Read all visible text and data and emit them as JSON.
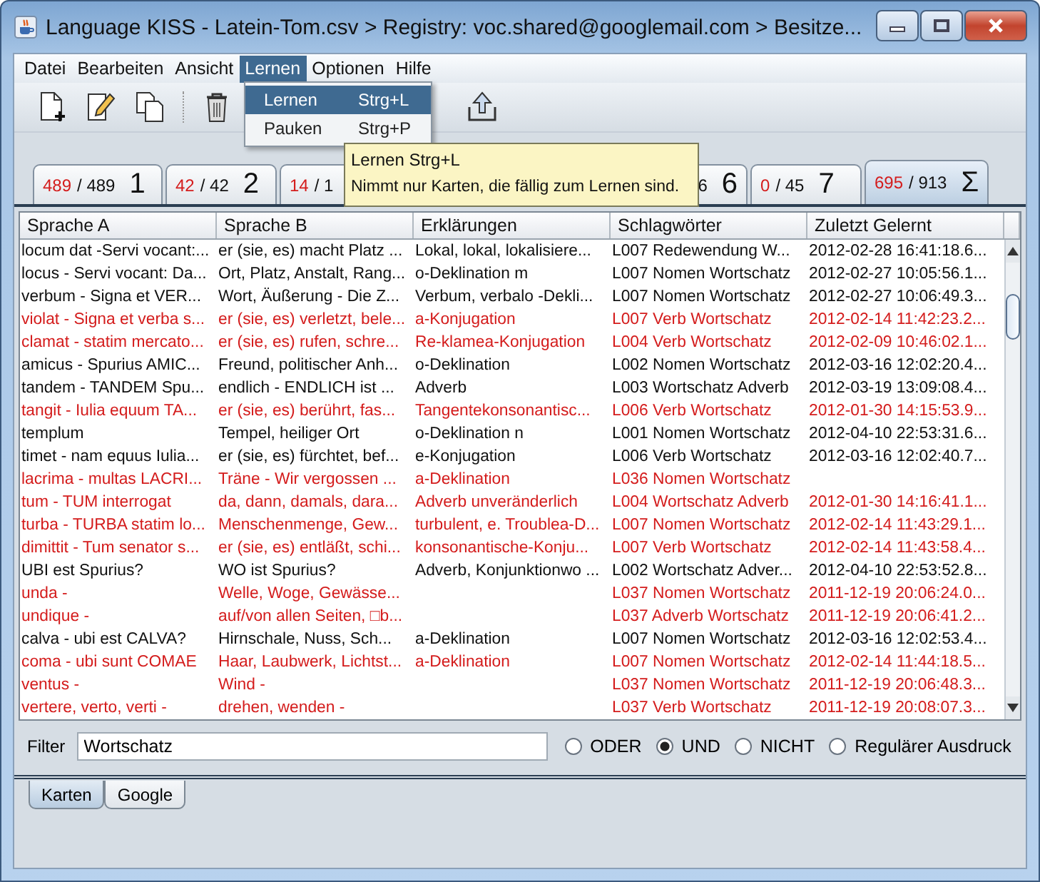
{
  "window": {
    "title": "Language KISS - Latein-Tom.csv > Registry: voc.shared@googlemail.com > Besitze..."
  },
  "menu": [
    {
      "label": "Datei",
      "selected": false
    },
    {
      "label": "Bearbeiten",
      "selected": false
    },
    {
      "label": "Ansicht",
      "selected": false
    },
    {
      "label": "Lernen",
      "selected": true
    },
    {
      "label": "Optionen",
      "selected": false
    },
    {
      "label": "Hilfe",
      "selected": false
    }
  ],
  "dropdown": [
    {
      "label": "Lernen",
      "shortcut": "Strg+L",
      "selected": true
    },
    {
      "label": "Pauken",
      "shortcut": "Strg+P",
      "selected": false
    }
  ],
  "toolbar": [
    {
      "kind": "new"
    },
    {
      "kind": "edit"
    },
    {
      "kind": "copy"
    },
    {
      "kind": "separator"
    },
    {
      "kind": "delete"
    },
    {
      "kind": "upload"
    }
  ],
  "tooltip": {
    "title": "Lernen Strg+L",
    "text": "Nimmt nur Karten, die fällig zum Lernen sind."
  },
  "deck_tabs": [
    {
      "due": "489",
      "rest": "/ 489",
      "number": "1",
      "selected": false
    },
    {
      "due": "42",
      "rest": "/ 42",
      "number": "2",
      "selected": false
    },
    {
      "due": "14",
      "rest": "/ 1",
      "selected": false,
      "kind": "covered"
    },
    {
      "rest": "6",
      "number": "6",
      "selected": false,
      "kind": "covered-right"
    },
    {
      "due": "0",
      "rest": "/ 45",
      "number": "7",
      "selected": false
    },
    {
      "due": "695",
      "rest": "/ 913",
      "number": "Σ",
      "selected": true
    }
  ],
  "table": {
    "columns": [
      "Sprache A",
      "Sprache B",
      "Erklärungen",
      "Schlagwörter",
      "Zuletzt Gelernt"
    ],
    "rows": [
      {
        "due": false,
        "cells": [
          "locum dat -Servi vocant:...",
          "er (sie, es) macht Platz ...",
          "Lokal, lokal, lokalisiere...",
          "L007 Redewendung W...",
          "2012-02-28 16:41:18.6..."
        ]
      },
      {
        "due": false,
        "cells": [
          "locus - Servi vocant: Da...",
          "Ort, Platz, Anstalt, Rang...",
          "o-Deklination m",
          "L007 Nomen Wortschatz",
          "2012-02-27 10:05:56.1..."
        ]
      },
      {
        "due": false,
        "cells": [
          "verbum - Signa et VER...",
          "Wort, Äußerung - Die Z...",
          "Verbum, verbalo -Dekli...",
          "L007 Nomen Wortschatz",
          "2012-02-27 10:06:49.3..."
        ]
      },
      {
        "due": true,
        "cells": [
          "violat - Signa et verba s...",
          "er (sie, es) verletzt, bele...",
          "a-Konjugation",
          "L007 Verb Wortschatz",
          "2012-02-14 11:42:23.2..."
        ]
      },
      {
        "due": true,
        "cells": [
          "clamat - statim mercato...",
          "er (sie, es) rufen, schre...",
          "Re-klamea-Konjugation",
          "L004 Verb Wortschatz",
          "2012-02-09 10:46:02.1..."
        ]
      },
      {
        "due": false,
        "cells": [
          "amicus - Spurius AMIC...",
          "Freund, politischer Anh...",
          "o-Deklination",
          "L002 Nomen Wortschatz",
          "2012-03-16 12:02:20.4..."
        ]
      },
      {
        "due": false,
        "cells": [
          "tandem - TANDEM Spu...",
          "endlich - ENDLICH ist ...",
          "Adverb",
          "L003 Wortschatz Adverb",
          "2012-03-19 13:09:08.4..."
        ]
      },
      {
        "due": true,
        "cells": [
          "tangit - Iulia equum TA...",
          "er (sie, es) berührt, fas...",
          "Tangentekonsonantisc...",
          "L006 Verb Wortschatz",
          "2012-01-30 14:15:53.9..."
        ]
      },
      {
        "due": false,
        "cells": [
          "templum",
          "Tempel, heiliger Ort",
          "o-Deklination n",
          "L001 Nomen Wortschatz",
          "2012-04-10 22:53:31.6..."
        ]
      },
      {
        "due": false,
        "cells": [
          "timet - nam equus Iulia...",
          "er (sie, es) fürchtet, bef...",
          "e-Konjugation",
          "L006 Verb Wortschatz",
          "2012-03-16 12:02:40.7..."
        ]
      },
      {
        "due": true,
        "cells": [
          "lacrima - multas LACRI...",
          "Träne - Wir vergossen ...",
          "a-Deklination",
          "L036 Nomen Wortschatz",
          null
        ]
      },
      {
        "due": true,
        "cells": [
          "tum - TUM interrogat",
          "da, dann, damals, dara...",
          "Adverb unveränderlich",
          "L004 Wortschatz Adverb",
          "2012-01-30 14:16:41.1..."
        ]
      },
      {
        "due": true,
        "cells": [
          "turba - TURBA statim lo...",
          "Menschenmenge, Gew...",
          "turbulent, e. Troublea-D...",
          "L007 Nomen Wortschatz",
          "2012-02-14 11:43:29.1..."
        ]
      },
      {
        "due": true,
        "cells": [
          "dimittit - Tum senator s...",
          "er (sie, es) entläßt, schi...",
          "konsonantische-Konju...",
          "L007 Verb Wortschatz",
          "2012-02-14 11:43:58.4..."
        ]
      },
      {
        "due": false,
        "cells": [
          "UBI est Spurius?",
          "WO ist Spurius?",
          "Adverb, Konjunktionwo ...",
          "L002 Wortschatz Adver...",
          "2012-04-10 22:53:52.8..."
        ]
      },
      {
        "due": true,
        "cells": [
          "unda -",
          "Welle, Woge, Gewässe...",
          null,
          "L037 Nomen Wortschatz",
          "2011-12-19 20:06:24.0..."
        ]
      },
      {
        "due": true,
        "cells": [
          "undique -",
          "auf/von allen Seiten, □b...",
          null,
          "L037 Adverb Wortschatz",
          "2011-12-19 20:06:41.2..."
        ]
      },
      {
        "due": false,
        "cells": [
          "calva - ubi est CALVA?",
          "Hirnschale, Nuss, Sch...",
          "a-Deklination",
          "L007 Nomen Wortschatz",
          "2012-03-16 12:02:53.4..."
        ]
      },
      {
        "due": true,
        "cells": [
          "coma - ubi sunt COMAE",
          "Haar, Laubwerk, Lichtst...",
          "a-Deklination",
          "L007 Nomen Wortschatz",
          "2012-02-14 11:44:18.5..."
        ]
      },
      {
        "due": true,
        "cells": [
          "ventus -",
          "Wind -",
          null,
          "L037 Nomen Wortschatz",
          "2011-12-19 20:06:48.3..."
        ]
      },
      {
        "due": true,
        "cells": [
          "vertere, verto, verti -",
          "drehen, wenden -",
          null,
          "L037 Verb Wortschatz",
          "2011-12-19 20:08:07.3..."
        ]
      }
    ]
  },
  "filter": {
    "label": "Filter",
    "value": "Wortschatz"
  },
  "filter_modes": [
    {
      "label": "ODER",
      "selected": false
    },
    {
      "label": "UND",
      "selected": true
    },
    {
      "label": "NICHT",
      "selected": false
    },
    {
      "label": "Regulärer Ausdruck",
      "selected": false
    }
  ],
  "bottom_tabs": [
    {
      "label": "Karten",
      "selected": true
    },
    {
      "label": "Google",
      "selected": false
    }
  ]
}
